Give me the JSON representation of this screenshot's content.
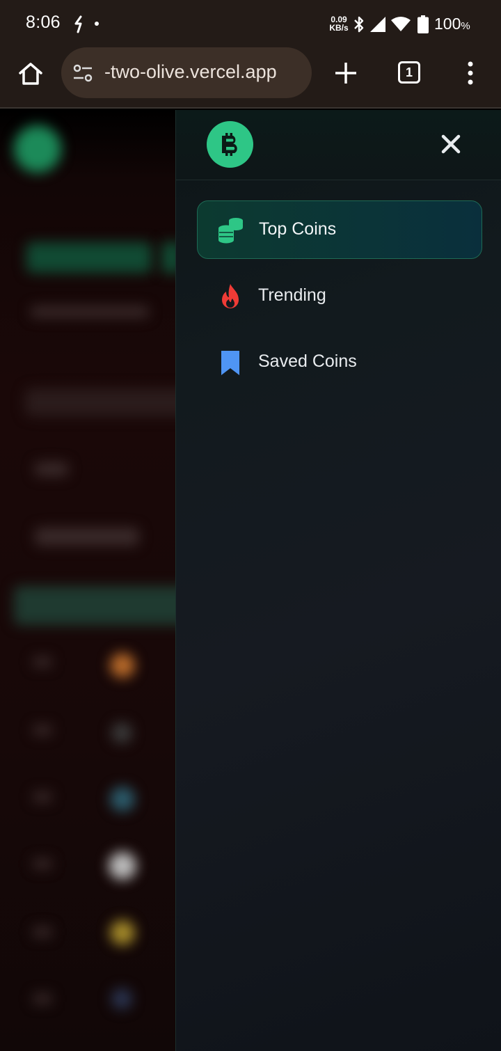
{
  "status_bar": {
    "time": "8:06",
    "net_speed_value": "0.09",
    "net_speed_unit": "KB/s",
    "battery_percent": "100",
    "battery_unit": "%"
  },
  "browser": {
    "url": "-two-olive.vercel.app",
    "tab_count": "1"
  },
  "drawer": {
    "logo_icon": "bitcoin-icon",
    "brand_color": "#2ec686",
    "nav": [
      {
        "label": "Top Coins",
        "icon": "coins-stack-icon",
        "active": true,
        "icon_color": "#2ec686"
      },
      {
        "label": "Trending",
        "icon": "flame-icon",
        "active": false,
        "icon_color": "#ef3b36"
      },
      {
        "label": "Saved Coins",
        "icon": "bookmark-icon",
        "active": false,
        "icon_color": "#4f95f4"
      }
    ]
  }
}
